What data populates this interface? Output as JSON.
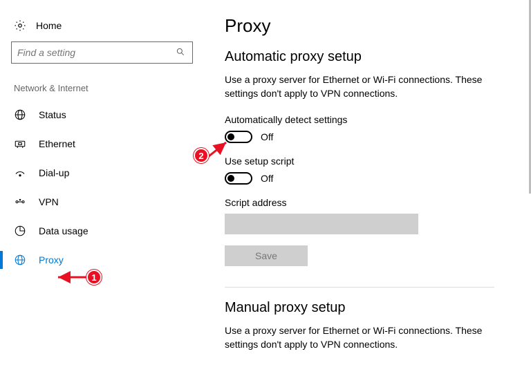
{
  "home": {
    "label": "Home"
  },
  "search": {
    "placeholder": "Find a setting"
  },
  "section_header": "Network & Internet",
  "nav": [
    {
      "id": "status",
      "label": "Status",
      "active": false
    },
    {
      "id": "ethernet",
      "label": "Ethernet",
      "active": false
    },
    {
      "id": "dialup",
      "label": "Dial-up",
      "active": false
    },
    {
      "id": "vpn",
      "label": "VPN",
      "active": false
    },
    {
      "id": "data-usage",
      "label": "Data usage",
      "active": false
    },
    {
      "id": "proxy",
      "label": "Proxy",
      "active": true
    }
  ],
  "page": {
    "title": "Proxy",
    "auto": {
      "heading": "Automatic proxy setup",
      "desc": "Use a proxy server for Ethernet or Wi-Fi connections. These settings don't apply to VPN connections.",
      "auto_detect": {
        "label": "Automatically detect settings",
        "state": "Off"
      },
      "setup_script": {
        "label": "Use setup script",
        "state": "Off"
      },
      "script_address": {
        "label": "Script address",
        "value": ""
      },
      "save_label": "Save"
    },
    "manual": {
      "heading": "Manual proxy setup",
      "desc": "Use a proxy server for Ethernet or Wi-Fi connections. These settings don't apply to VPN connections."
    }
  },
  "annotations": {
    "callout1": "1",
    "callout2": "2"
  }
}
